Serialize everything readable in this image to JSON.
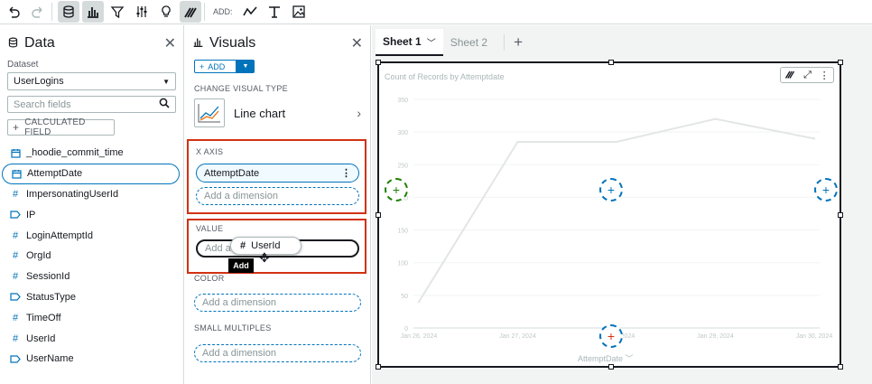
{
  "toolbar": {
    "add_label": "ADD:"
  },
  "data_panel": {
    "title": "Data",
    "dataset_label": "Dataset",
    "dataset_value": "UserLogins",
    "search_placeholder": "Search fields",
    "calc_field_label": "CALCULATED FIELD",
    "fields": [
      {
        "name": "_hoodie_commit_time",
        "type": "date"
      },
      {
        "name": "AttemptDate",
        "type": "date"
      },
      {
        "name": "ImpersonatingUserId",
        "type": "number"
      },
      {
        "name": "IP",
        "type": "string"
      },
      {
        "name": "LoginAttemptId",
        "type": "number"
      },
      {
        "name": "OrgId",
        "type": "number"
      },
      {
        "name": "SessionId",
        "type": "number"
      },
      {
        "name": "StatusType",
        "type": "string"
      },
      {
        "name": "TimeOff",
        "type": "number"
      },
      {
        "name": "UserId",
        "type": "number"
      },
      {
        "name": "UserName",
        "type": "string"
      }
    ]
  },
  "visuals_panel": {
    "title": "Visuals",
    "add_label": "ADD",
    "change_type_label": "CHANGE VISUAL TYPE",
    "visual_type": "Line chart",
    "x_axis_label": "X AXIS",
    "x_axis_field": "AttemptDate",
    "add_dimension": "Add a dimension",
    "value_label": "VALUE",
    "value_placeholder": "Add a",
    "color_label": "COLOR",
    "small_multiples_label": "SMALL MULTIPLES"
  },
  "drag": {
    "chip_label": "UserId",
    "tooltip": "Add"
  },
  "canvas": {
    "tabs": [
      "Sheet 1",
      "Sheet 2"
    ],
    "visual_title": "Count of Records by Attemptdate",
    "x_axis_title": "AttemptDate"
  },
  "chart_data": {
    "type": "line",
    "title": "Count of Records by Attemptdate",
    "xlabel": "AttemptDate",
    "ylabel": "",
    "x_ticks": [
      "Jan 26, 2024",
      "Jan 27, 2024",
      "Jan 28, 2024",
      "Jan 29, 2024",
      "Jan 30, 2024"
    ],
    "y_ticks": [
      0,
      50,
      100,
      150,
      200,
      250,
      300,
      350
    ],
    "ylim": [
      0,
      350
    ],
    "series": [
      {
        "values": [
          40,
          285,
          285,
          320,
          290
        ]
      }
    ]
  }
}
